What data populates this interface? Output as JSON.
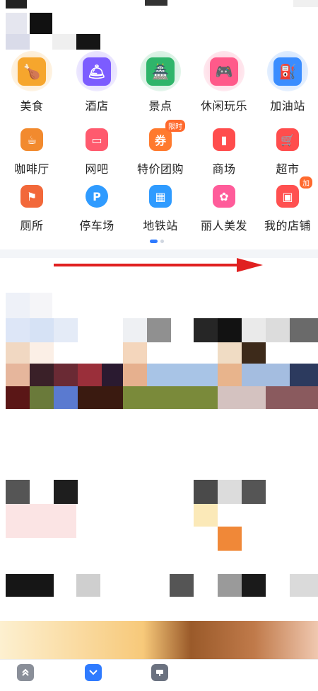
{
  "categories": [
    {
      "label": "美食",
      "icon": "food-icon",
      "color": "#f6a62d"
    },
    {
      "label": "酒店",
      "icon": "hotel-icon",
      "color": "#7c5cff"
    },
    {
      "label": "景点",
      "icon": "attraction-icon",
      "color": "#2fb56a"
    },
    {
      "label": "休闲玩乐",
      "icon": "gamepad-icon",
      "color": "#ff5a8a"
    },
    {
      "label": "加油站",
      "icon": "gas-station-icon",
      "color": "#3a8dff"
    },
    {
      "label": "咖啡厅",
      "icon": "coffee-icon",
      "color": "#f28a2e"
    },
    {
      "label": "网吧",
      "icon": "monitor-icon",
      "color": "#ff5a6e"
    },
    {
      "label": "特价团购",
      "icon": "group-deal-icon",
      "color": "#ff7a2e",
      "badge": "限时"
    },
    {
      "label": "商场",
      "icon": "mall-icon",
      "color": "#ff4d4d"
    },
    {
      "label": "超市",
      "icon": "cart-icon",
      "color": "#ff4d4d"
    },
    {
      "label": "厕所",
      "icon": "toilet-icon",
      "color": "#f2683a"
    },
    {
      "label": "停车场",
      "icon": "parking-icon",
      "color": "#2f9bff"
    },
    {
      "label": "地铁站",
      "icon": "subway-icon",
      "color": "#2f9bff"
    },
    {
      "label": "丽人美发",
      "icon": "beauty-icon",
      "color": "#ff5c9a"
    },
    {
      "label": "我的店铺",
      "icon": "store-icon",
      "color": "#ff5050",
      "badge": "加"
    }
  ],
  "pagination": {
    "pages": 2,
    "current": 1
  },
  "colors": {
    "accent": "#2f7bff",
    "arrow": "#e02020"
  }
}
